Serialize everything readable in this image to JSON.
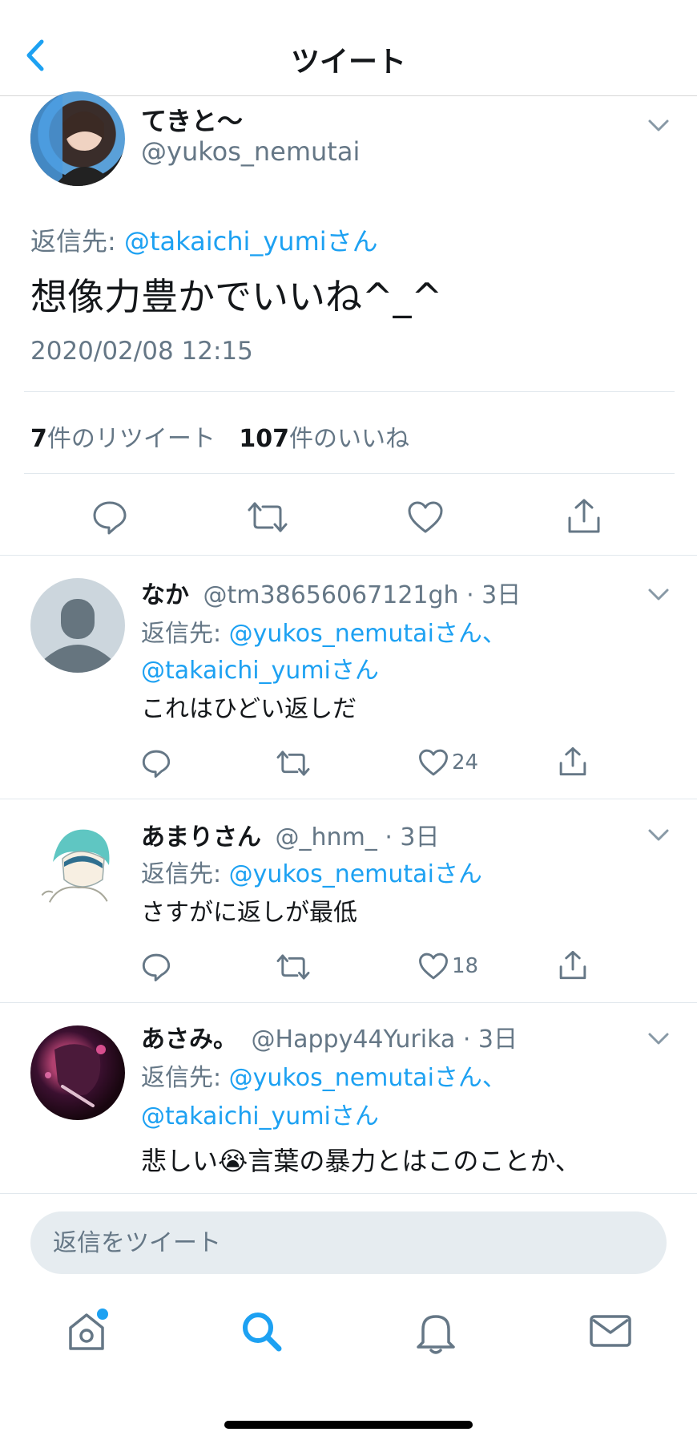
{
  "header": {
    "title": "ツイート"
  },
  "main_tweet": {
    "display_name": "てきと〜",
    "handle": "@yukos_nemutai",
    "reply_to_prefix": "返信先: ",
    "reply_to_handle": "@takaichi_yumiさん",
    "text": "想像力豊かでいいね^_^",
    "timestamp": "2020/02/08 12:15",
    "retweet_count": "7",
    "retweet_label": "件のリツイート",
    "like_count": "107",
    "like_label": "件のいいね"
  },
  "replies": [
    {
      "display_name": "なか",
      "handle": "@tm38656067121gh",
      "time": "· 3日",
      "reply_to_prefix": "返信先: ",
      "reply_to_line1": "@yukos_nemutaiさん、",
      "reply_to_line2": "@takaichi_yumiさん",
      "text": "これはひどい返しだ",
      "like_count": "24"
    },
    {
      "display_name": "あまりさん",
      "handle": "@_hnm_",
      "time": "· 3日",
      "reply_to_prefix": "返信先: ",
      "reply_to_line1": "@yukos_nemutaiさん",
      "text": "さすがに返しが最低",
      "like_count": "18"
    },
    {
      "display_name": "あさみ。",
      "handle": "@Happy44Yurika",
      "time": "· 3日",
      "reply_to_prefix": "返信先: ",
      "reply_to_line1": "@yukos_nemutaiさん、",
      "reply_to_line2": "@takaichi_yumiさん",
      "text_before_emoji": "悲しい",
      "emoji": "😭",
      "text_after_emoji": "言葉の暴力とはこのことか、"
    }
  ],
  "composer": {
    "placeholder": "返信をツイート"
  },
  "tabs": {
    "home_icon": "home-icon",
    "search_icon": "search-icon",
    "notifications_icon": "bell-icon",
    "messages_icon": "mail-icon"
  },
  "colors": {
    "accent": "#1da1f2",
    "muted": "#657786",
    "divider": "#e1e8ed"
  }
}
